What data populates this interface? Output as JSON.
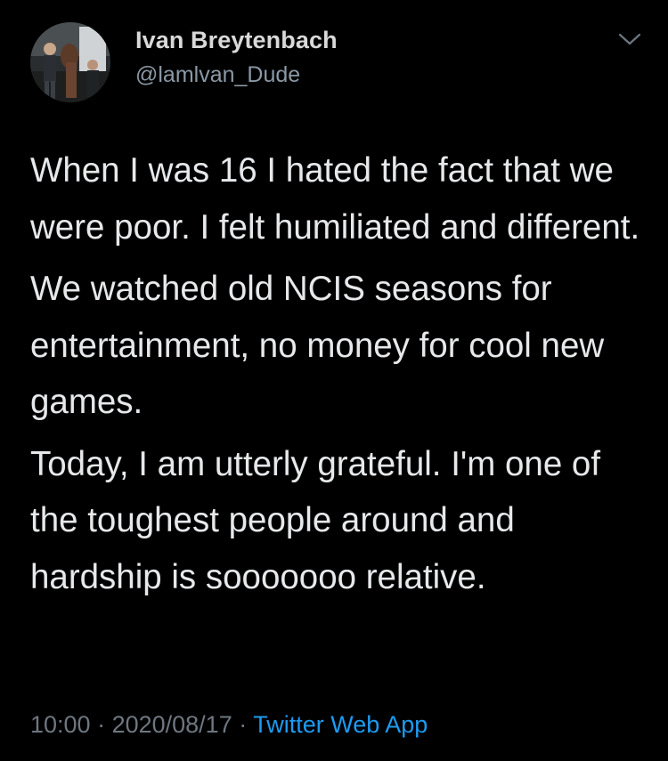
{
  "user": {
    "display_name": "Ivan Breytenbach",
    "handle": "@lamlvan_Dude"
  },
  "tweet": {
    "paragraphs": [
      "When I was 16 I hated the fact that we were poor. I felt humiliated and different.",
      "We watched old NCIS seasons for entertainment, no money for cool new games.",
      "Today, I am utterly grateful. I'm one of the toughest people around and hardship is sooooooo relative."
    ]
  },
  "meta": {
    "time": "10:00",
    "separator": " · ",
    "date": "2020/08/17",
    "source": "Twitter Web App"
  },
  "icons": {
    "more": "chevron-down-icon"
  },
  "colors": {
    "background": "#000000",
    "text": "#e6e8ea",
    "secondary": "#8b98a5",
    "link": "#1d9bf0"
  }
}
